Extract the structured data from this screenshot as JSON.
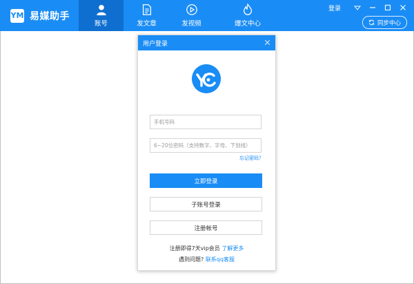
{
  "app": {
    "name": "易媒助手",
    "logo_glyph": "YM"
  },
  "nav": [
    {
      "label": "账号",
      "icon": "user-icon",
      "active": true
    },
    {
      "label": "发文章",
      "icon": "document-icon",
      "active": false
    },
    {
      "label": "发视频",
      "icon": "play-circle-icon",
      "active": false
    },
    {
      "label": "爆文中心",
      "icon": "flame-icon",
      "active": false
    }
  ],
  "top_right": {
    "login": "登录",
    "sync": "同步中心"
  },
  "dialog": {
    "title": "用户登录",
    "phone_placeholder": "手机号码",
    "password_placeholder": "6~20位密码（支持数字、字母、下划线）",
    "forgot": "忘记密码？",
    "login_button": "立即登录",
    "sub_account_button": "子账号登录",
    "register_button": "注册帐号",
    "promo_text": "注册即得7天vip会员",
    "promo_link": "了解更多",
    "help_text": "遇到问题?",
    "help_link": "联系qq客服"
  },
  "colors": {
    "primary": "#1a8cf5",
    "active_nav": "#0f6fd0"
  }
}
